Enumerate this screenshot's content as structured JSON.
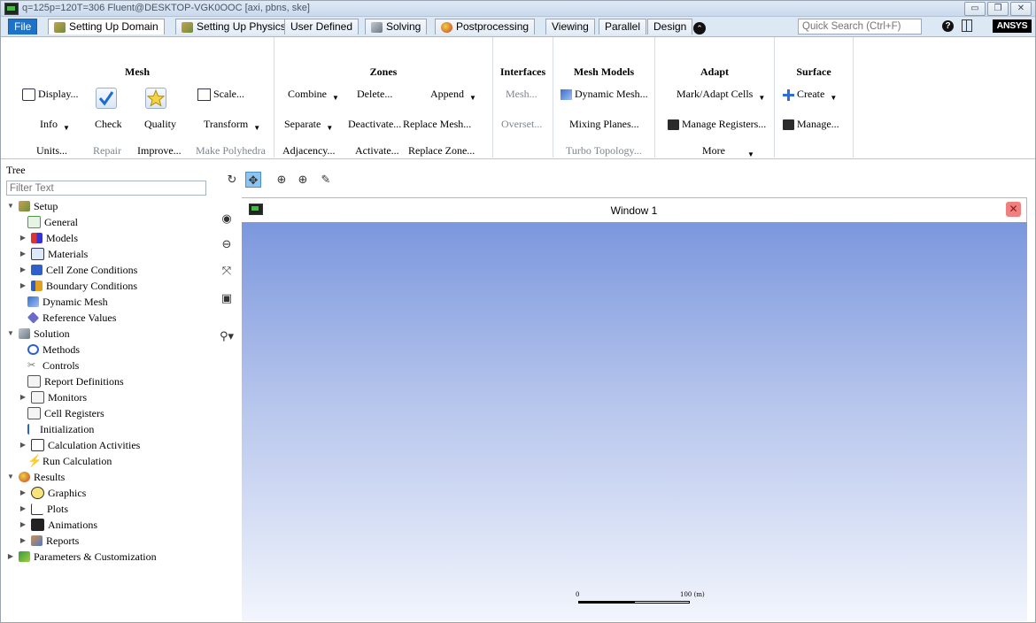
{
  "titlebar": {
    "title": "q=125p=120T=306 Fluent@DESKTOP-VGK0OOC  [axi, pbns, ske]"
  },
  "tabs": [
    {
      "label": "File"
    },
    {
      "label": "Setting Up Domain"
    },
    {
      "label": "Setting Up Physics"
    },
    {
      "label": "User Defined"
    },
    {
      "label": "Solving"
    },
    {
      "label": "Postprocessing"
    },
    {
      "label": "Viewing"
    },
    {
      "label": "Parallel"
    },
    {
      "label": "Design"
    }
  ],
  "search": {
    "placeholder": "Quick Search (Ctrl+F)"
  },
  "brand": {
    "logo": "ANSYS"
  },
  "ribbon": {
    "mesh": {
      "title": "Mesh",
      "display": "Display...",
      "info": "Info",
      "units": "Units...",
      "check": "Check",
      "repair": "Repair",
      "quality": "Quality",
      "improve": "Improve...",
      "scale": "Scale...",
      "transform": "Transform",
      "make_polyhedra": "Make Polyhedra"
    },
    "zones": {
      "title": "Zones",
      "combine": "Combine",
      "separate": "Separate",
      "adjacency": "Adjacency...",
      "delete": "Delete...",
      "deactivate": "Deactivate...",
      "activate": "Activate...",
      "append": "Append",
      "replace_mesh": "Replace Mesh...",
      "replace_zone": "Replace Zone..."
    },
    "interfaces": {
      "title": "Interfaces",
      "mesh": "Mesh...",
      "overset": "Overset..."
    },
    "mesh_models": {
      "title": "Mesh Models",
      "dynamic_mesh": "Dynamic Mesh...",
      "mixing_planes": "Mixing Planes...",
      "turbo_topology": "Turbo Topology..."
    },
    "adapt": {
      "title": "Adapt",
      "mark_adapt": "Mark/Adapt Cells",
      "manage_registers": "Manage Registers...",
      "more": "More"
    },
    "surface": {
      "title": "Surface",
      "create": "Create",
      "manage": "Manage..."
    }
  },
  "tree": {
    "label": "Tree",
    "filter_placeholder": "Filter Text",
    "items": [
      {
        "label": "Setup"
      },
      {
        "label": "General"
      },
      {
        "label": "Models"
      },
      {
        "label": "Materials"
      },
      {
        "label": "Cell Zone Conditions"
      },
      {
        "label": "Boundary Conditions"
      },
      {
        "label": "Dynamic Mesh"
      },
      {
        "label": "Reference Values"
      },
      {
        "label": "Solution"
      },
      {
        "label": "Methods"
      },
      {
        "label": "Controls"
      },
      {
        "label": "Report Definitions"
      },
      {
        "label": "Monitors"
      },
      {
        "label": "Cell Registers"
      },
      {
        "label": "Initialization"
      },
      {
        "label": "Calculation Activities"
      },
      {
        "label": "Run Calculation"
      },
      {
        "label": "Results"
      },
      {
        "label": "Graphics"
      },
      {
        "label": "Plots"
      },
      {
        "label": "Animations"
      },
      {
        "label": "Reports"
      },
      {
        "label": "Parameters & Customization"
      }
    ]
  },
  "graphics": {
    "window_title": "Window 1",
    "scale_start": "0",
    "scale_end": "100 (m)"
  }
}
